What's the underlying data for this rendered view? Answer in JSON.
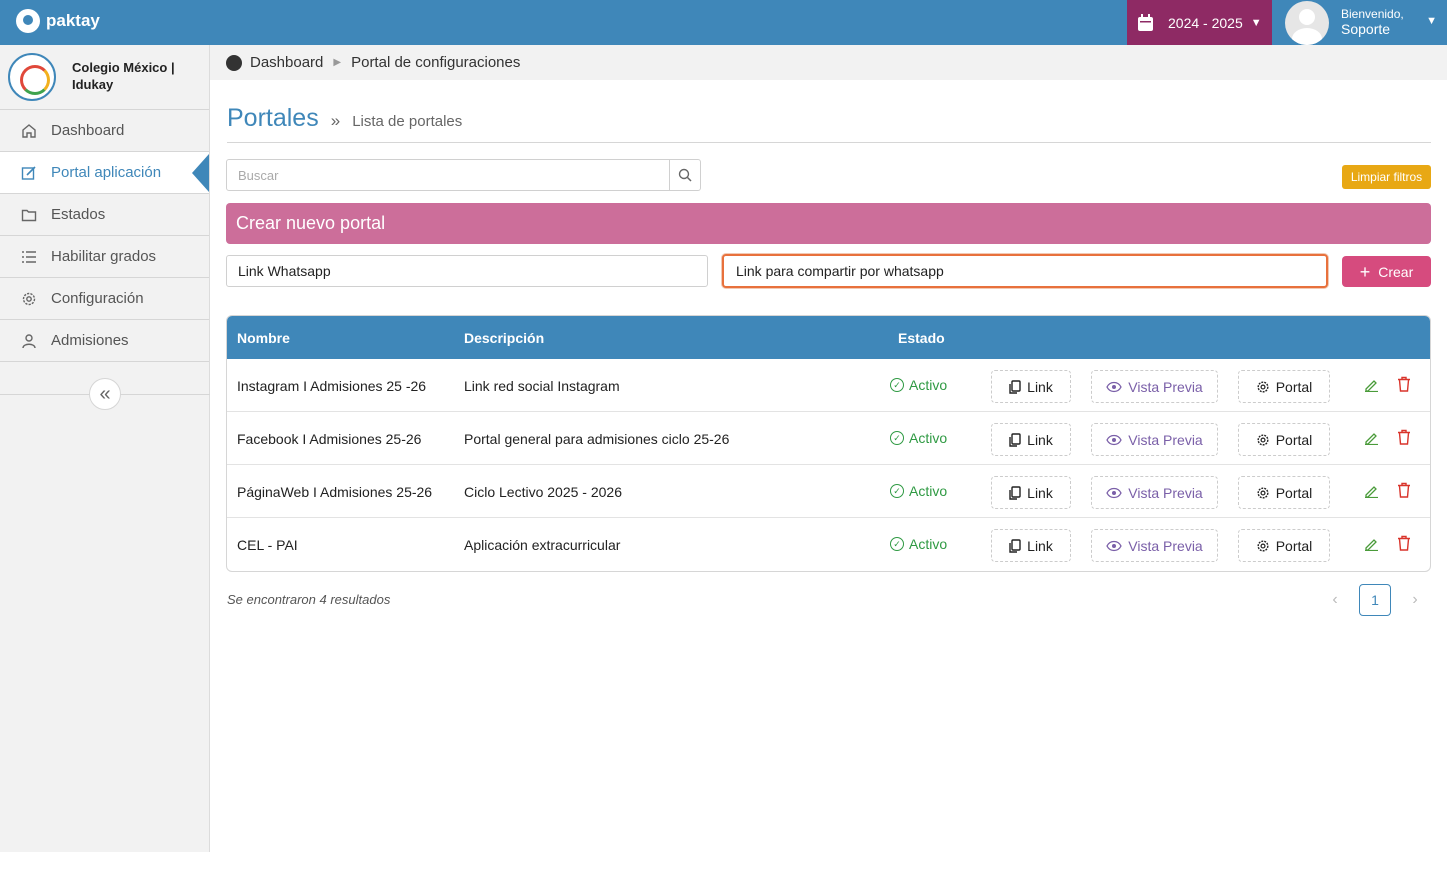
{
  "app": {
    "logo_text": "paktay"
  },
  "header": {
    "school_year": "2024 - 2025",
    "welcome": "Bienvenido,",
    "user_name": "Soporte"
  },
  "sidebar": {
    "school_name": "Colegio México | Idukay",
    "items": [
      {
        "label": "Dashboard",
        "icon": "home-icon"
      },
      {
        "label": "Portal aplicación",
        "icon": "edit-icon",
        "active": true
      },
      {
        "label": "Estados",
        "icon": "folder-icon"
      },
      {
        "label": "Habilitar grados",
        "icon": "list-icon"
      },
      {
        "label": "Configuración",
        "icon": "gear-icon"
      },
      {
        "label": "Admisiones",
        "icon": "user-icon"
      }
    ]
  },
  "breadcrumb": {
    "home": "Dashboard",
    "current": "Portal de configuraciones"
  },
  "page": {
    "title": "Portales",
    "subtitle": "Lista de portales",
    "search_placeholder": "Buscar",
    "clear_filters": "Limpiar filtros",
    "create_title": "Crear nuevo portal",
    "new_name_value": "Link Whatsapp",
    "new_desc_value": "Link para compartir por whatsapp",
    "create_button": "Crear"
  },
  "table": {
    "headers": {
      "name": "Nombre",
      "description": "Descripción",
      "status": "Estado"
    },
    "button_labels": {
      "link": "Link",
      "preview": "Vista Previa",
      "portal": "Portal"
    },
    "rows": [
      {
        "name": "Instagram I Admisiones 25 -26",
        "description": "Link red social Instagram",
        "status": "Activo"
      },
      {
        "name": "Facebook I Admisiones 25-26",
        "description": "Portal general para admisiones ciclo 25-26",
        "status": "Activo"
      },
      {
        "name": "PáginaWeb I Admisiones 25-26",
        "description": "Ciclo Lectivo 2025 - 2026",
        "status": "Activo"
      },
      {
        "name": "CEL - PAI",
        "description": "Aplicación extracurricular",
        "status": "Activo"
      }
    ]
  },
  "footer": {
    "results_text": "Se encontraron 4 resultados",
    "current_page": "1"
  },
  "colors": {
    "primary": "#3f87b9",
    "year_bg": "#8e2a64",
    "create_bar": "#cc6e9a",
    "create_btn": "#d64b7e",
    "clear_btn": "#e8a814",
    "active_status": "#2f9a43"
  }
}
